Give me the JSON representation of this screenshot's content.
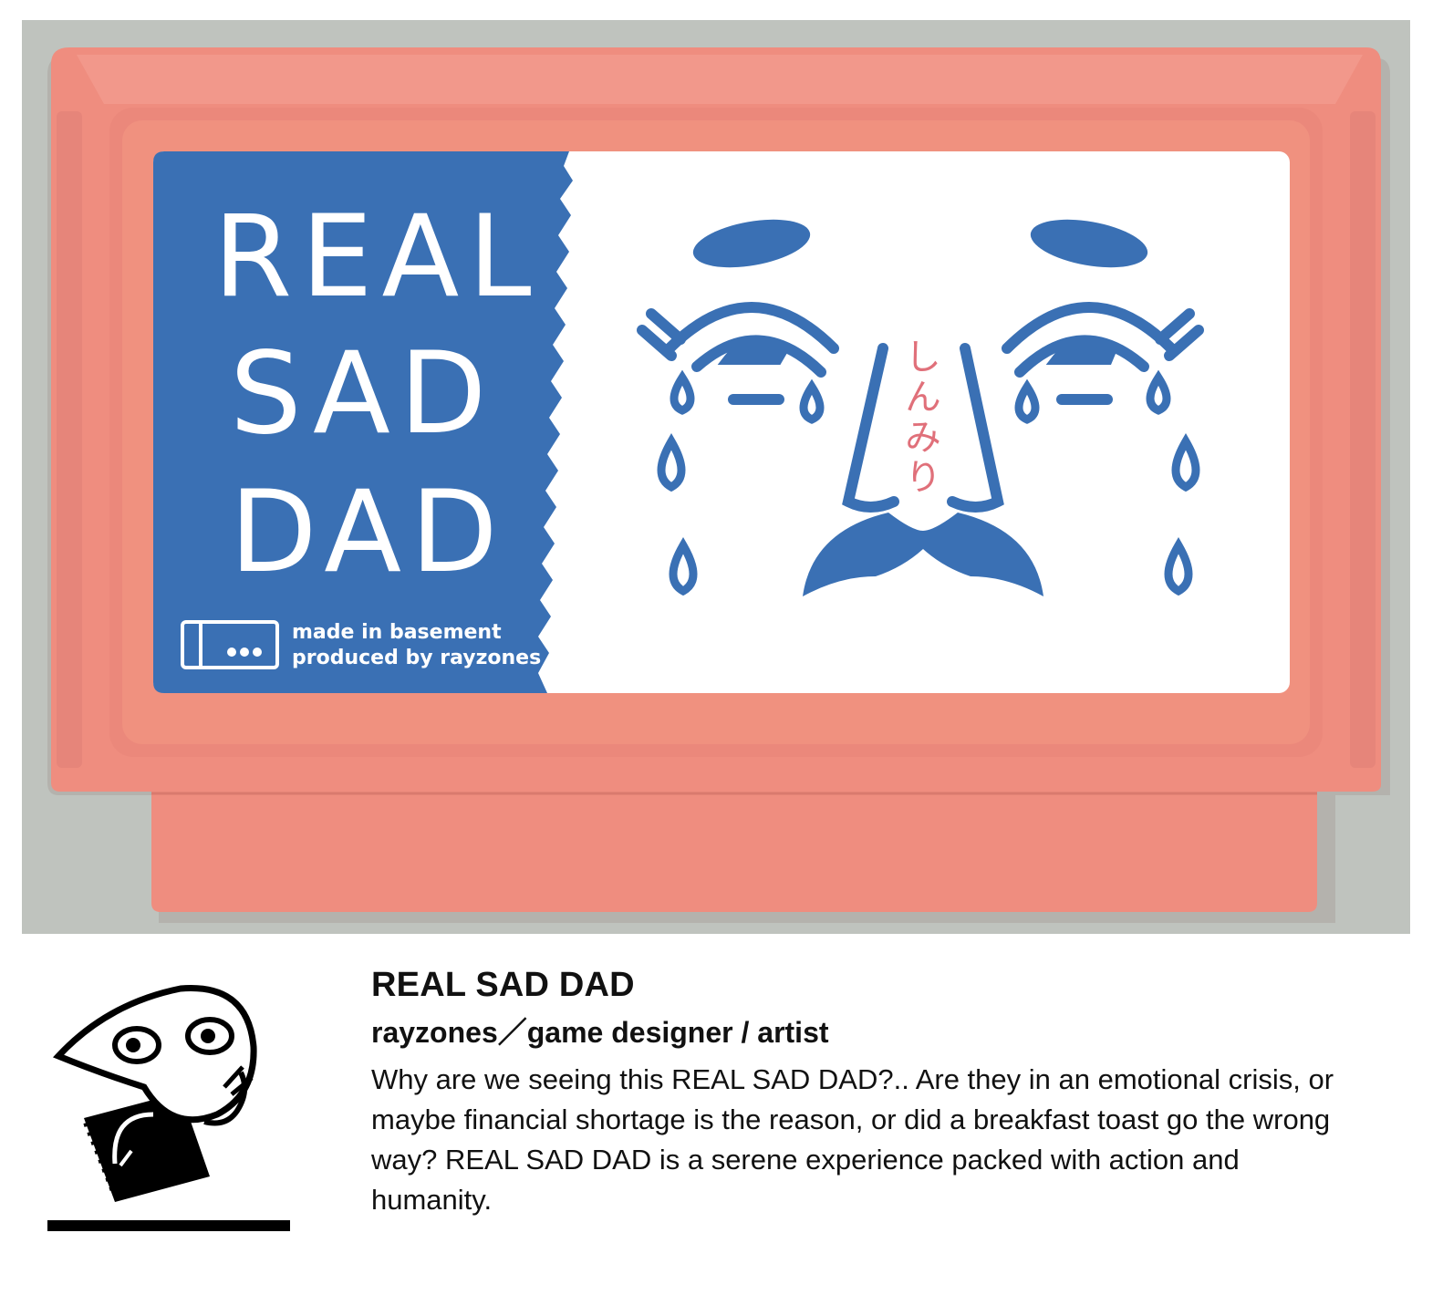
{
  "cartridge": {
    "label_title_lines": [
      "REAL",
      "SAD",
      "DAD"
    ],
    "label_made_in": "made in basement",
    "label_produced_by": "produced by rayzones",
    "label_japanese": "しんみり",
    "colors": {
      "cartridge": "#ef8d7f",
      "label_blue": "#3a70b4",
      "label_white": "#ffffff",
      "japanese_text": "#e0707a",
      "background": "#bfc3be"
    }
  },
  "game": {
    "title": "REAL SAD DAD",
    "credit": "rayzones／game designer / artist",
    "description": "Why are we seeing this REAL SAD DAD?.. Are they in an emotional crisis, or maybe financial shortage is the reason, or did a breakfast toast go the wrong way? REAL SAD DAD is a serene experience packed with action and humanity."
  }
}
